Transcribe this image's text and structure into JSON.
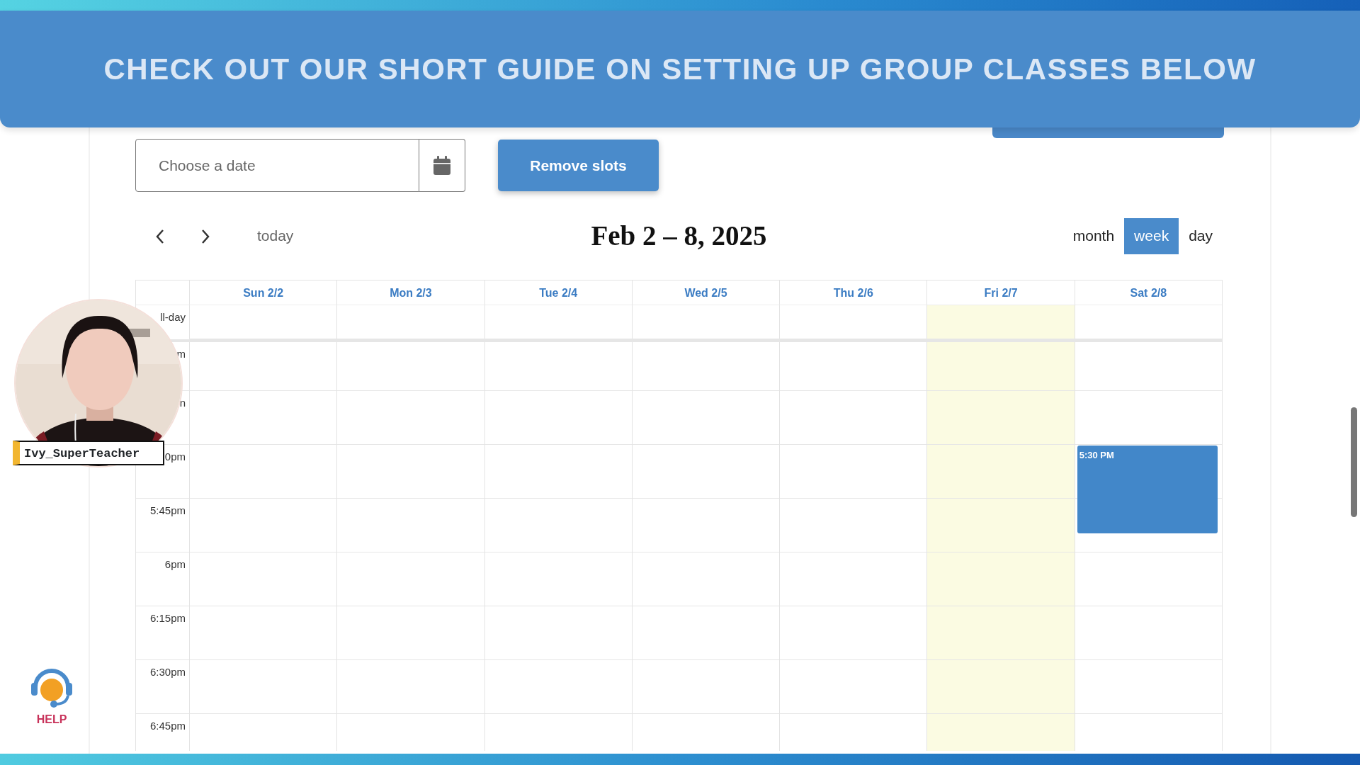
{
  "banner": {
    "text": "CHECK OUT OUR SHORT GUIDE ON SETTING UP GROUP CLASSES BELOW"
  },
  "date_picker": {
    "placeholder": "Choose a date"
  },
  "remove_button": {
    "label": "Remove slots"
  },
  "toolbar": {
    "today": "today",
    "title": "Feb 2 – 8, 2025",
    "views": [
      {
        "label": "month",
        "selected": false
      },
      {
        "label": "week",
        "selected": true
      },
      {
        "label": "day",
        "selected": false
      }
    ]
  },
  "calendar": {
    "all_day_label": "ll-day",
    "days": [
      {
        "label": "Sun 2/2",
        "today": false
      },
      {
        "label": "Mon 2/3",
        "today": false
      },
      {
        "label": "Tue 2/4",
        "today": false
      },
      {
        "label": "Wed 2/5",
        "today": false
      },
      {
        "label": "Thu 2/6",
        "today": false
      },
      {
        "label": "Fri 2/7",
        "today": true
      },
      {
        "label": "Sat 2/8",
        "today": false,
        "events": [
          {
            "time": "5:30 PM"
          }
        ]
      }
    ],
    "time_labels": [
      "m",
      "n",
      "0pm",
      "5:45pm",
      "6pm",
      "6:15pm",
      "6:30pm",
      "6:45pm"
    ]
  },
  "presenter": {
    "name": "Ivy_SuperTeacher",
    "kind": "picture"
  },
  "help": {
    "label": "HELP"
  }
}
